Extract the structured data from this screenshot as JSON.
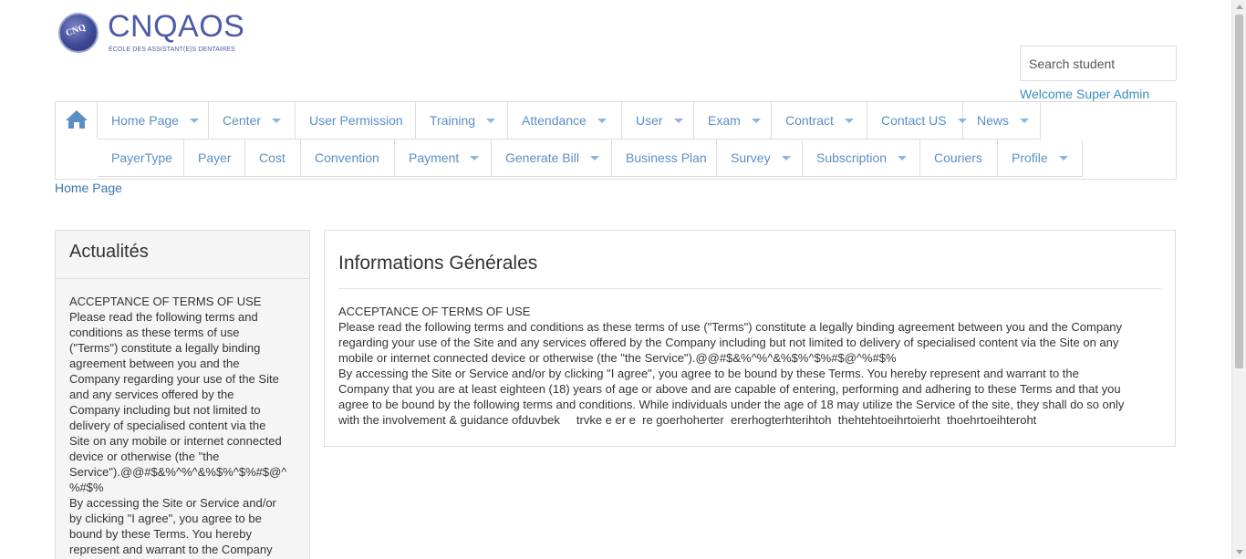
{
  "logo": {
    "title": "CNQAOS",
    "subtitle": "ÉCOLE DES ASSISTANT(E)S DENTAIRES",
    "mark": "CNQ"
  },
  "search": {
    "placeholder": "Search student"
  },
  "welcome": "Welcome Super Admin",
  "nav": {
    "home_icon": "home-icon",
    "row1": [
      {
        "label": "Home Page",
        "dropdown": true
      },
      {
        "label": "Center",
        "dropdown": true
      },
      {
        "label": "User Permission",
        "dropdown": false
      },
      {
        "label": "Training",
        "dropdown": true
      },
      {
        "label": "Attendance",
        "dropdown": true
      },
      {
        "label": "User",
        "dropdown": true
      },
      {
        "label": "Exam",
        "dropdown": true
      },
      {
        "label": "Contract",
        "dropdown": true
      },
      {
        "label": "Contact US",
        "dropdown": true
      },
      {
        "label": "News",
        "dropdown": true
      }
    ],
    "row2": [
      {
        "label": "PayerType",
        "dropdown": false
      },
      {
        "label": "Payer",
        "dropdown": false
      },
      {
        "label": "Cost",
        "dropdown": false
      },
      {
        "label": "Convention",
        "dropdown": false
      },
      {
        "label": "Payment",
        "dropdown": true
      },
      {
        "label": "Generate Bill",
        "dropdown": true
      },
      {
        "label": "Business Plan",
        "dropdown": false
      },
      {
        "label": "Survey",
        "dropdown": true
      },
      {
        "label": "Subscription",
        "dropdown": true
      },
      {
        "label": "Couriers",
        "dropdown": false
      },
      {
        "label": "Profile",
        "dropdown": true
      }
    ]
  },
  "breadcrumb": "Home Page",
  "news_panel": {
    "heading": "Actualités",
    "lines": [
      "ACCEPTANCE OF TERMS OF USE",
      "Please read the following terms and",
      "conditions as these terms of use",
      "(\"Terms\") constitute a legally binding",
      "agreement between you and the",
      "Company regarding your use of the Site",
      "and any services offered by the",
      "Company including but not limited to",
      "delivery of specialised content via the",
      "Site on any mobile or internet connected",
      "device or otherwise (the \"the",
      "Service\").@@#$&%^%^&%$%^$%#$@^",
      "%#$%",
      "By accessing the Site or Service and/or",
      "by clicking \"I agree\", you agree to be",
      "bound by these Terms. You hereby",
      "represent and warrant to the Company"
    ]
  },
  "info_panel": {
    "title": "Informations Générales",
    "lines": [
      "ACCEPTANCE OF TERMS OF USE",
      "Please read the following terms and conditions as these terms of use (\"Terms\") constitute a legally binding agreement between you and the Company",
      "regarding your use of the Site and any services offered by the Company including but not limited to delivery of specialised content via the Site on any",
      "mobile or internet connected device or otherwise (the \"the Service\").@@#$&%^%^&%$%^$%#$@^%#$%",
      "By accessing the Site or Service and/or by clicking \"I agree\", you agree to be bound by these Terms. You hereby represent and warrant to the",
      "Company that you are at least eighteen (18) years of age or above and are capable of entering, performing and adhering to these Terms and that you",
      "agree to be bound by the following terms and conditions. While individuals under the age of 18 may utilize the Service of the site, they shall do so only",
      "with the involvement & guidance ofduvbek     trvke e er e  re goerhoherter  ererhogterhterihtoh  thehtehtoeihrtoierht  thoehrtoeihteroht"
    ]
  }
}
